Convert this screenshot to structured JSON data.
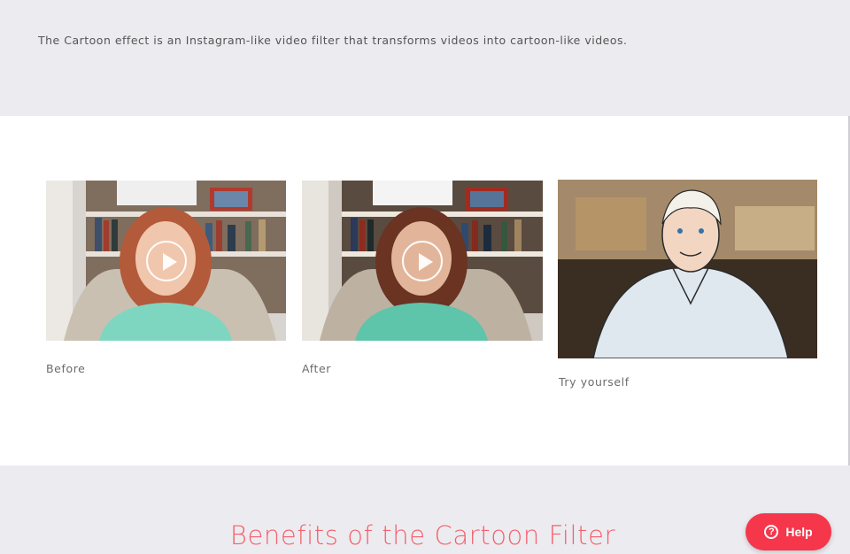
{
  "intro_text": "The Cartoon effect is an Instagram-like video filter that transforms videos into cartoon-like videos.",
  "examples": [
    {
      "caption": "Before"
    },
    {
      "caption": "After"
    },
    {
      "caption": "Try yourself"
    }
  ],
  "section_heading": "Benefits of the Cartoon Filter",
  "help_button": {
    "label": "Help",
    "icon": "?"
  },
  "colors": {
    "accent": "#f4616e",
    "help_bg": "#f5364b",
    "page_bg": "#ececf0"
  }
}
